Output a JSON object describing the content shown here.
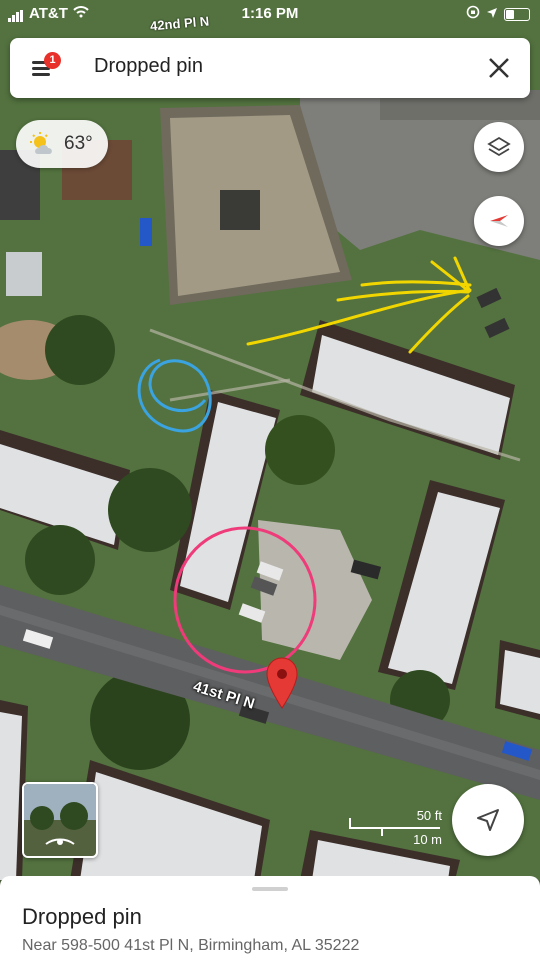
{
  "status_bar": {
    "carrier": "AT&T",
    "time": "1:16 PM"
  },
  "search": {
    "title": "Dropped pin",
    "notification_count": "1"
  },
  "weather": {
    "temperature": "63°"
  },
  "map": {
    "top_street_label": "42nd Pl N",
    "road_label": "41st Pl N",
    "scale_feet": "50 ft",
    "scale_meters": "10 m"
  },
  "sheet": {
    "title": "Dropped pin",
    "address": "Near 598-500 41st Pl N, Birmingham, AL 35222"
  },
  "colors": {
    "pin": "#e53935",
    "accent": "#e53935"
  },
  "icons": [
    "menu-icon",
    "close-icon",
    "sun-icon",
    "layers-icon",
    "compass-icon",
    "location-arrow-icon",
    "street-view-icon"
  ]
}
